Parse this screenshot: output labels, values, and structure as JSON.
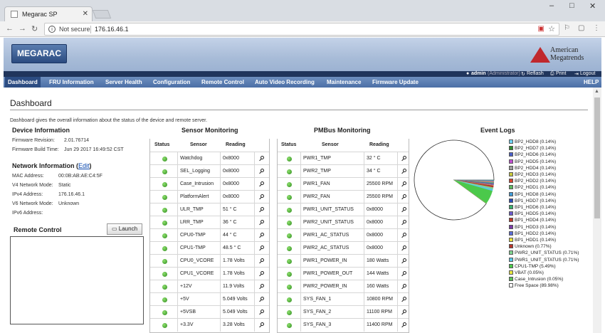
{
  "browser": {
    "tab_title": "Megarac SP",
    "security_label": "Not secure",
    "url": "176.16.46.1",
    "window_buttons": [
      "–",
      "□",
      "✕"
    ]
  },
  "branding": {
    "logo_text": "MEGARAC",
    "company_line1": "American",
    "company_line2": "Megatrends",
    "brand_color": "#c0282d"
  },
  "userbar": {
    "user": "admin",
    "role": "(Administrator)",
    "refresh": "Reflash",
    "print": "Print",
    "logout": "Logout"
  },
  "menu": {
    "items": [
      "Dashboard",
      "FRU Information",
      "Server Health",
      "Configuration",
      "Remote Control",
      "Auto Video Recording",
      "Maintenance",
      "Firmware Update"
    ],
    "help": "HELP",
    "active": "Dashboard"
  },
  "page": {
    "title": "Dashboard",
    "description": "Dashboard gives the overall information about the status of the device and remote server."
  },
  "device_info": {
    "heading": "Device Information",
    "fw_revision_label": "Firmware Revision:",
    "fw_revision": "2.01.76714",
    "fw_build_label": "Firmware Build Time:",
    "fw_build": "Jun 29 2017 16:49:52 CST"
  },
  "network_info": {
    "heading": "Network Information",
    "edit_label": "Edit",
    "mac_label": "MAC Address:",
    "mac": "00:0B:AB:AE:C4:5F",
    "v4mode_label": "V4 Network Mode:",
    "v4mode": "Static",
    "ipv4_label": "IPv4 Address:",
    "ipv4": "176.16.46.1",
    "v6mode_label": "V6 Network Mode:",
    "v6mode": "Unknown",
    "ipv6_label": "IPv6 Address:",
    "ipv6": ""
  },
  "remote_control": {
    "heading": "Remote Control",
    "launch_label": "Launch"
  },
  "sensor_monitoring": {
    "heading": "Sensor Monitoring",
    "columns": [
      "Status",
      "Sensor",
      "Reading"
    ],
    "rows": [
      {
        "sensor": "Watchdog",
        "reading": "0x8000"
      },
      {
        "sensor": "SEL_Logging",
        "reading": "0x8000"
      },
      {
        "sensor": "Case_Intrusion",
        "reading": "0x8000"
      },
      {
        "sensor": "PlatformAlert",
        "reading": "0x8000"
      },
      {
        "sensor": "ULR_TMP",
        "reading": "51 ° C"
      },
      {
        "sensor": "LRR_TMP",
        "reading": "36 ° C"
      },
      {
        "sensor": "CPU0-TMP",
        "reading": "44 ° C"
      },
      {
        "sensor": "CPU1-TMP",
        "reading": "48.5 ° C"
      },
      {
        "sensor": "CPU0_VCORE",
        "reading": "1.78 Volts"
      },
      {
        "sensor": "CPU1_VCORE",
        "reading": "1.78 Volts"
      },
      {
        "sensor": "+12V",
        "reading": "11.9 Volts"
      },
      {
        "sensor": "+5V",
        "reading": "5.049 Volts"
      },
      {
        "sensor": "+5VSB",
        "reading": "5.049 Volts"
      },
      {
        "sensor": "+3.3V",
        "reading": "3.28 Volts"
      }
    ]
  },
  "pmbus_monitoring": {
    "heading": "PMBus Monitoring",
    "columns": [
      "Status",
      "Sensor",
      "Reading"
    ],
    "rows": [
      {
        "sensor": "PWR1_TMP",
        "reading": "32 ° C"
      },
      {
        "sensor": "PWR2_TMP",
        "reading": "34 ° C"
      },
      {
        "sensor": "PWR1_FAN",
        "reading": "25500 RPM"
      },
      {
        "sensor": "PWR2_FAN",
        "reading": "25500 RPM"
      },
      {
        "sensor": "PWR1_UNIT_STATUS",
        "reading": "0x8000"
      },
      {
        "sensor": "PWR2_UNIT_STATUS",
        "reading": "0x8000"
      },
      {
        "sensor": "PWR1_AC_STATUS",
        "reading": "0x8000"
      },
      {
        "sensor": "PWR2_AC_STATUS",
        "reading": "0x8000"
      },
      {
        "sensor": "PWR1_POWER_IN",
        "reading": "180 Watts"
      },
      {
        "sensor": "PWR1_POWER_OUT",
        "reading": "144 Watts"
      },
      {
        "sensor": "PWR2_POWER_IN",
        "reading": "160 Watts"
      },
      {
        "sensor": "SYS_FAN_1",
        "reading": "10800 RPM"
      },
      {
        "sensor": "SYS_FAN_2",
        "reading": "11100 RPM"
      },
      {
        "sensor": "SYS_FAN_3",
        "reading": "11400 RPM"
      }
    ]
  },
  "event_logs": {
    "heading": "Event Logs",
    "entries": [
      {
        "label": "BP2_HDD8 (0.14%)",
        "pct": 0.14,
        "color": "#6fd3f5"
      },
      {
        "label": "BP2_HDD7 (0.14%)",
        "pct": 0.14,
        "color": "#2e8b2e"
      },
      {
        "label": "BP2_HDD6 (0.14%)",
        "pct": 0.14,
        "color": "#4a5fc8"
      },
      {
        "label": "BP2_HDD5 (0.14%)",
        "pct": 0.14,
        "color": "#c24fd1"
      },
      {
        "label": "BP2_HDD4 (0.14%)",
        "pct": 0.14,
        "color": "#9c9c9c"
      },
      {
        "label": "BP2_HDD3 (0.14%)",
        "pct": 0.14,
        "color": "#c8c83c"
      },
      {
        "label": "BP2_HDD2 (0.14%)",
        "pct": 0.14,
        "color": "#d9432f"
      },
      {
        "label": "BP2_HDD1 (0.14%)",
        "pct": 0.14,
        "color": "#5fb85f"
      },
      {
        "label": "BP1_HDD8 (0.14%)",
        "pct": 0.14,
        "color": "#3f9ad6"
      },
      {
        "label": "BP1_HDD7 (0.14%)",
        "pct": 0.14,
        "color": "#2a4cba"
      },
      {
        "label": "BP1_HDD6 (0.14%)",
        "pct": 0.14,
        "color": "#3ab06c"
      },
      {
        "label": "BP1_HDD5 (0.14%)",
        "pct": 0.14,
        "color": "#6a5acd"
      },
      {
        "label": "BP1_HDD4 (0.14%)",
        "pct": 0.14,
        "color": "#c0392b"
      },
      {
        "label": "BP1_HDD3 (0.14%)",
        "pct": 0.14,
        "color": "#7a3aa8"
      },
      {
        "label": "BP1_HDD2 (0.14%)",
        "pct": 0.14,
        "color": "#5a6bd6"
      },
      {
        "label": "BP1_HDD1 (0.14%)",
        "pct": 0.14,
        "color": "#e8e03a"
      },
      {
        "label": "Unknown (0.77%)",
        "pct": 0.77,
        "color": "#b5352a"
      },
      {
        "label": "PWR2_UNIT_STATUS (0.71%)",
        "pct": 0.71,
        "color": "#7fd28f"
      },
      {
        "label": "PWR1_UNIT_STATUS (0.71%)",
        "pct": 0.71,
        "color": "#58c7e8"
      },
      {
        "label": "CPU1-TMP (5.49%)",
        "pct": 5.49,
        "color": "#4bc94b"
      },
      {
        "label": "VBAT (0.05%)",
        "pct": 0.05,
        "color": "#e6e640"
      },
      {
        "label": "Case_Intrusion (0.05%)",
        "pct": 0.05,
        "color": "#5bbf5b"
      },
      {
        "label": "Free Space (89.98%)",
        "pct": 89.98,
        "color": "#ffffff"
      }
    ]
  }
}
